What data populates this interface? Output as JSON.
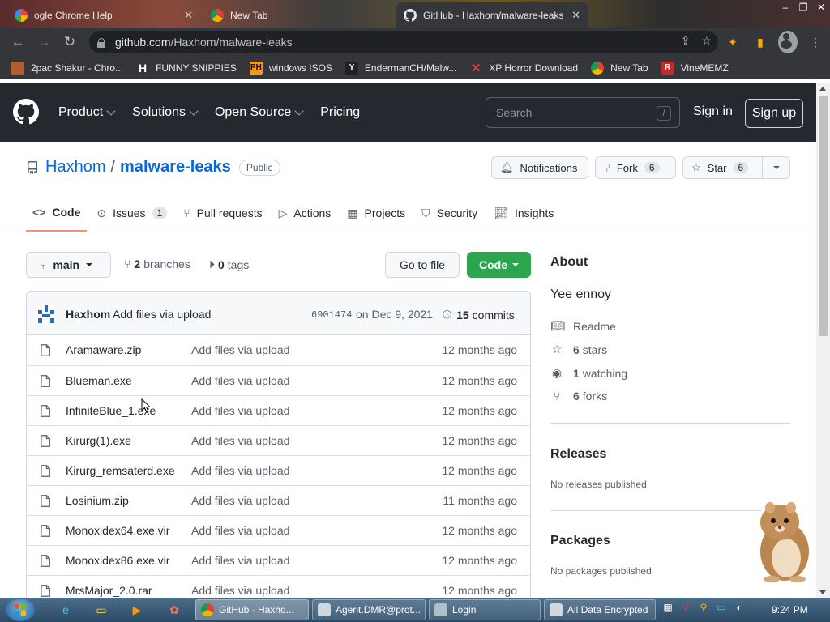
{
  "browser": {
    "tabs": [
      {
        "label": "Google Chrome Help",
        "visible_label": "ogle Chrome Help"
      },
      {
        "label": "New Tab"
      },
      {
        "label": "GitHub - Haxhom/malware-leaks",
        "active": true
      }
    ],
    "url_host": "github.com",
    "url_path": "/Haxhom/malware-leaks",
    "bookmarks": [
      {
        "label": "2pac Shakur - Chro...",
        "icon": "album-icon"
      },
      {
        "label": "FUNNY SNIPPIES",
        "icon": "h-logo-icon"
      },
      {
        "label": "windows ISOS",
        "icon": "ph-logo-icon"
      },
      {
        "label": "EndermanCH/Malw...",
        "icon": "yc-logo-icon"
      },
      {
        "label": "XP Horror Download",
        "icon": "x-icon"
      },
      {
        "label": "New Tab",
        "icon": "chrome-icon"
      },
      {
        "label": "VineMEMZ",
        "icon": "r-logo-icon"
      }
    ]
  },
  "github": {
    "nav": [
      "Product",
      "Solutions",
      "Open Source",
      "Pricing"
    ],
    "search_placeholder": "Search",
    "search_key": "/",
    "sign_in": "Sign in",
    "sign_up": "Sign up"
  },
  "repo": {
    "owner": "Haxhom",
    "separator": "/",
    "name": "malware-leaks",
    "visibility": "Public",
    "notifications_label": "Notifications",
    "fork_label": "Fork",
    "fork_count": "6",
    "star_label": "Star",
    "star_count": "6",
    "tabs": [
      {
        "label": "Code",
        "icon": "code-icon"
      },
      {
        "label": "Issues",
        "icon": "issue-icon",
        "count": "1"
      },
      {
        "label": "Pull requests",
        "icon": "pull-request-icon"
      },
      {
        "label": "Actions",
        "icon": "play-icon"
      },
      {
        "label": "Projects",
        "icon": "table-icon"
      },
      {
        "label": "Security",
        "icon": "shield-icon"
      },
      {
        "label": "Insights",
        "icon": "graph-icon"
      }
    ],
    "branch": "main",
    "branches_count": "2",
    "branches_label": "branches",
    "tags_count": "0",
    "tags_label": "tags",
    "go_to_file": "Go to file",
    "code_button": "Code",
    "latest_commit": {
      "author": "Haxhom",
      "message": "Add files via upload",
      "sha": "6901474",
      "date": "on Dec 9, 2021",
      "commits_count": "15",
      "commits_label": "commits"
    },
    "files": [
      {
        "name": "Aramaware.zip",
        "message": "Add files via upload",
        "age": "12 months ago"
      },
      {
        "name": "Blueman.exe",
        "message": "Add files via upload",
        "age": "12 months ago"
      },
      {
        "name": "InfiniteBlue_1.exe",
        "message": "Add files via upload",
        "age": "12 months ago"
      },
      {
        "name": "Kirurg(1).exe",
        "message": "Add files via upload",
        "age": "12 months ago"
      },
      {
        "name": "Kirurg_remsaterd.exe",
        "message": "Add files via upload",
        "age": "12 months ago"
      },
      {
        "name": "Losinium.zip",
        "message": "Add files via upload",
        "age": "11 months ago"
      },
      {
        "name": "Monoxidex64.exe.vir",
        "message": "Add files via upload",
        "age": "12 months ago"
      },
      {
        "name": "Monoxidex86.exe.vir",
        "message": "Add files via upload",
        "age": "12 months ago"
      },
      {
        "name": "MrsMajor_2.0.rar",
        "message": "Add files via upload",
        "age": "12 months ago"
      }
    ],
    "about": {
      "heading": "About",
      "description": "Yee ennoy",
      "readme": "Readme",
      "stars_count": "6",
      "stars_label": "stars",
      "watching_count": "1",
      "watching_label": "watching",
      "forks_count": "6",
      "forks_label": "forks"
    },
    "releases": {
      "heading": "Releases",
      "sub": "No releases published"
    },
    "packages": {
      "heading": "Packages",
      "sub": "No packages published"
    }
  },
  "taskbar": {
    "tasks": [
      {
        "label": "GitHub - Haxho...",
        "active": true
      },
      {
        "label": "Agent.DMR@prot..."
      },
      {
        "label": "Login"
      },
      {
        "label": "All Data Encrypted"
      }
    ],
    "clock": "9:24 PM"
  }
}
